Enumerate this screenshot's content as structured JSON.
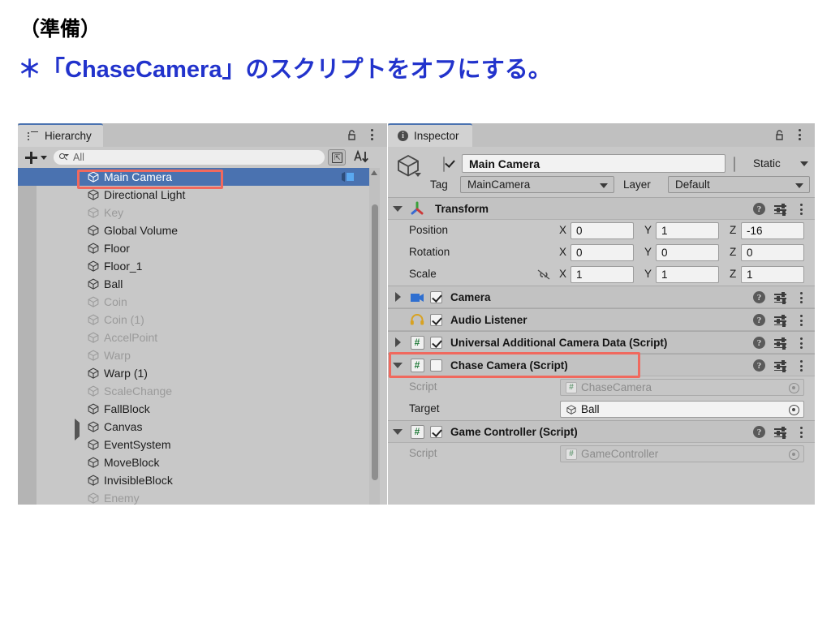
{
  "slide": {
    "line1": "（準備）",
    "line2": "＊「ChaseCamera」のスクリプトをオフにする。"
  },
  "colors": {
    "accent_blue": "#2233cc",
    "selection_blue": "#4a72b0",
    "annotation_red": "#f0695e",
    "panel_bg": "#c8c8c8",
    "component_header": "#c2c2c2",
    "field_bg": "#f2f2f2"
  },
  "hierarchy": {
    "tab_label": "Hierarchy",
    "tab_icon": "list-icon",
    "lock_icon": "lock-open-icon",
    "menu_icon": "kebab-menu-icon",
    "create_label": "+",
    "search": {
      "placeholder": "All",
      "value": ""
    },
    "search_icon": "search-icon",
    "perspective_icon": "open-in-window-icon",
    "sort_icon": "alphabetical-sort-icon",
    "items": [
      {
        "label": "Main Camera",
        "indent": 0,
        "dim": false,
        "selected": true,
        "expandable": false,
        "prefab_mark": true
      },
      {
        "label": "Directional Light",
        "indent": 0,
        "dim": false,
        "selected": false,
        "expandable": false,
        "prefab_mark": false
      },
      {
        "label": "Key",
        "indent": 0,
        "dim": true,
        "selected": false,
        "expandable": false,
        "prefab_mark": false
      },
      {
        "label": "Global Volume",
        "indent": 0,
        "dim": false,
        "selected": false,
        "expandable": false,
        "prefab_mark": false
      },
      {
        "label": "Floor",
        "indent": 0,
        "dim": false,
        "selected": false,
        "expandable": false,
        "prefab_mark": false
      },
      {
        "label": "Floor_1",
        "indent": 0,
        "dim": false,
        "selected": false,
        "expandable": false,
        "prefab_mark": false
      },
      {
        "label": "Ball",
        "indent": 0,
        "dim": false,
        "selected": false,
        "expandable": false,
        "prefab_mark": false
      },
      {
        "label": "Coin",
        "indent": 0,
        "dim": true,
        "selected": false,
        "expandable": false,
        "prefab_mark": false
      },
      {
        "label": "Coin (1)",
        "indent": 0,
        "dim": true,
        "selected": false,
        "expandable": false,
        "prefab_mark": false
      },
      {
        "label": "AccelPoint",
        "indent": 0,
        "dim": true,
        "selected": false,
        "expandable": false,
        "prefab_mark": false
      },
      {
        "label": "Warp",
        "indent": 0,
        "dim": true,
        "selected": false,
        "expandable": false,
        "prefab_mark": false
      },
      {
        "label": "Warp (1)",
        "indent": 0,
        "dim": false,
        "selected": false,
        "expandable": false,
        "prefab_mark": false
      },
      {
        "label": "ScaleChange",
        "indent": 0,
        "dim": true,
        "selected": false,
        "expandable": false,
        "prefab_mark": false
      },
      {
        "label": "FallBlock",
        "indent": 0,
        "dim": false,
        "selected": false,
        "expandable": false,
        "prefab_mark": false
      },
      {
        "label": "Canvas",
        "indent": 0,
        "dim": false,
        "selected": false,
        "expandable": true,
        "prefab_mark": false
      },
      {
        "label": "EventSystem",
        "indent": 0,
        "dim": false,
        "selected": false,
        "expandable": false,
        "prefab_mark": false
      },
      {
        "label": "MoveBlock",
        "indent": 0,
        "dim": false,
        "selected": false,
        "expandable": false,
        "prefab_mark": false
      },
      {
        "label": "InvisibleBlock",
        "indent": 0,
        "dim": false,
        "selected": false,
        "expandable": false,
        "prefab_mark": false
      },
      {
        "label": "Enemy",
        "indent": 0,
        "dim": true,
        "selected": false,
        "expandable": false,
        "prefab_mark": false
      }
    ]
  },
  "inspector": {
    "tab_label": "Inspector",
    "tab_icon": "info-icon",
    "lock_icon": "lock-open-icon",
    "menu_icon": "kebab-menu-icon",
    "gameobject": {
      "icon": "cube-icon",
      "enabled": true,
      "name": "Main Camera",
      "static_label": "Static",
      "static_checked": false,
      "tag_label": "Tag",
      "tag_value": "MainCamera",
      "layer_label": "Layer",
      "layer_value": "Default"
    },
    "components": [
      {
        "name": "Transform",
        "icon": "transform-axis-icon",
        "expanded": true,
        "has_enable_checkbox": false,
        "highlighted": false,
        "rows": [
          {
            "label": "Position",
            "type": "vector3",
            "x": "0",
            "y": "1",
            "z": "-16",
            "link": false
          },
          {
            "label": "Rotation",
            "type": "vector3",
            "x": "0",
            "y": "0",
            "z": "0",
            "link": false
          },
          {
            "label": "Scale",
            "type": "vector3",
            "x": "1",
            "y": "1",
            "z": "1",
            "link": true
          }
        ]
      },
      {
        "name": "Camera",
        "icon": "camera-icon",
        "expanded": false,
        "has_enable_checkbox": true,
        "enabled": true,
        "highlighted": false,
        "rows": []
      },
      {
        "name": "Audio Listener",
        "icon": "headphones-icon",
        "expanded": false,
        "has_twisty": false,
        "has_enable_checkbox": true,
        "enabled": true,
        "highlighted": false,
        "rows": []
      },
      {
        "name": "Universal Additional Camera Data (Script)",
        "icon": "script-icon",
        "expanded": false,
        "has_enable_checkbox": true,
        "enabled": true,
        "highlighted": false,
        "rows": []
      },
      {
        "name": "Chase Camera (Script)",
        "icon": "script-icon",
        "expanded": true,
        "has_enable_checkbox": true,
        "enabled": false,
        "highlighted": true,
        "rows": [
          {
            "label": "Script",
            "type": "object",
            "value": "ChaseCamera",
            "value_icon": "script-icon",
            "disabled": true
          },
          {
            "label": "Target",
            "type": "object",
            "value": "Ball",
            "value_icon": "cube-icon",
            "disabled": false
          }
        ]
      },
      {
        "name": "Game Controller (Script)",
        "icon": "script-icon",
        "expanded": true,
        "has_enable_checkbox": true,
        "enabled": true,
        "highlighted": false,
        "rows": [
          {
            "label": "Script",
            "type": "object",
            "value": "GameController",
            "value_icon": "script-icon",
            "disabled": true
          }
        ]
      }
    ],
    "help_icon": "help-icon",
    "preset_icon": "preset-sliders-icon",
    "kebab_icon": "kebab-menu-icon"
  }
}
